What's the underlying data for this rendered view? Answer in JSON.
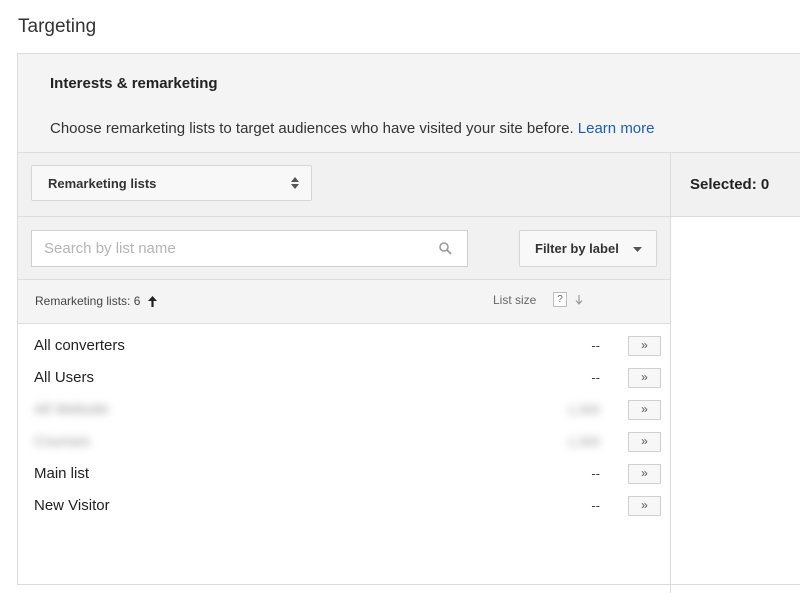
{
  "page": {
    "title": "Targeting"
  },
  "section": {
    "title": "Interests & remarketing",
    "description": "Choose remarketing lists to target audiences who have visited your site before.",
    "learn_more": "Learn more"
  },
  "type_select": {
    "value": "Remarketing lists"
  },
  "selected": {
    "label": "Selected: 0"
  },
  "search": {
    "placeholder": "Search by list name",
    "value": ""
  },
  "filter": {
    "label": "Filter by label"
  },
  "list_header": {
    "count_label": "Remarketing lists:",
    "count": "6",
    "size_label": "List size",
    "help": "?"
  },
  "rows": [
    {
      "name": "All converters",
      "size": "--",
      "add": "»",
      "redacted": false
    },
    {
      "name": "All Users",
      "size": "--",
      "add": "»",
      "redacted": false
    },
    {
      "name": "All Website",
      "size": "1,300",
      "add": "»",
      "redacted": true
    },
    {
      "name": "Courses",
      "size": "1,300",
      "add": "»",
      "redacted": true
    },
    {
      "name": "Main list",
      "size": "--",
      "add": "»",
      "redacted": false
    },
    {
      "name": "New Visitor",
      "size": "--",
      "add": "»",
      "redacted": false
    }
  ],
  "colors": {
    "link": "#1a5fb4",
    "panel_bg": "#f4f4f4",
    "border": "#dcdcdc"
  },
  "icons": [
    "updown-icon",
    "search-icon",
    "caret-down-icon",
    "arrow-up-icon",
    "arrow-down-icon",
    "help-icon"
  ]
}
